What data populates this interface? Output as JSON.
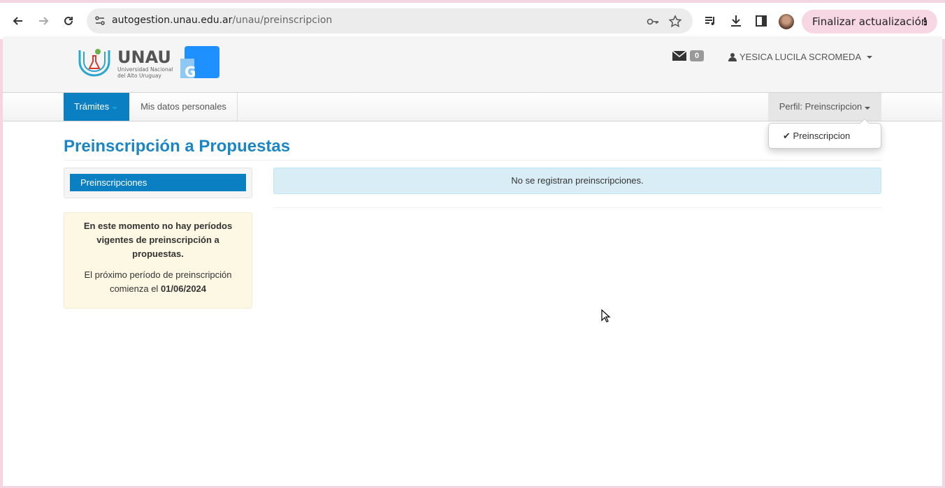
{
  "browser": {
    "url_domain": "autogestion.unau.edu.ar",
    "url_path": "/unau/preinscripcion",
    "update_label": "Finalizar actualización"
  },
  "header": {
    "logo_name": "UNAU",
    "logo_subtitle_line1": "Universidad Nacional",
    "logo_subtitle_line2": "del Alto Uruguay",
    "logo_badge": "G",
    "mail_count": "0",
    "user_name": "YESICA LUCILA SCROMEDA"
  },
  "navbar": {
    "tramites_label": "Trámites",
    "datos_label": "Mis datos personales",
    "perfil_label": "Perfil: Preinscripcion",
    "dropdown_item": "Preinscripcion"
  },
  "main": {
    "title": "Preinscripción a Propuestas",
    "side_tab": "Preinscripciones",
    "warning_bold": "En este momento no hay períodos vigentes de preinscripción a propuestas.",
    "warning_text": "El próximo período de preinscripción comienza el",
    "warning_date": "01/06/2024",
    "info_message": "No se registran preinscripciones."
  },
  "colors": {
    "primary": "#0a7fc2",
    "title": "#1a86c4",
    "info_bg": "#d9edf7",
    "warn_bg": "#fcf8e3",
    "logo_blue": "#1e90ff"
  }
}
